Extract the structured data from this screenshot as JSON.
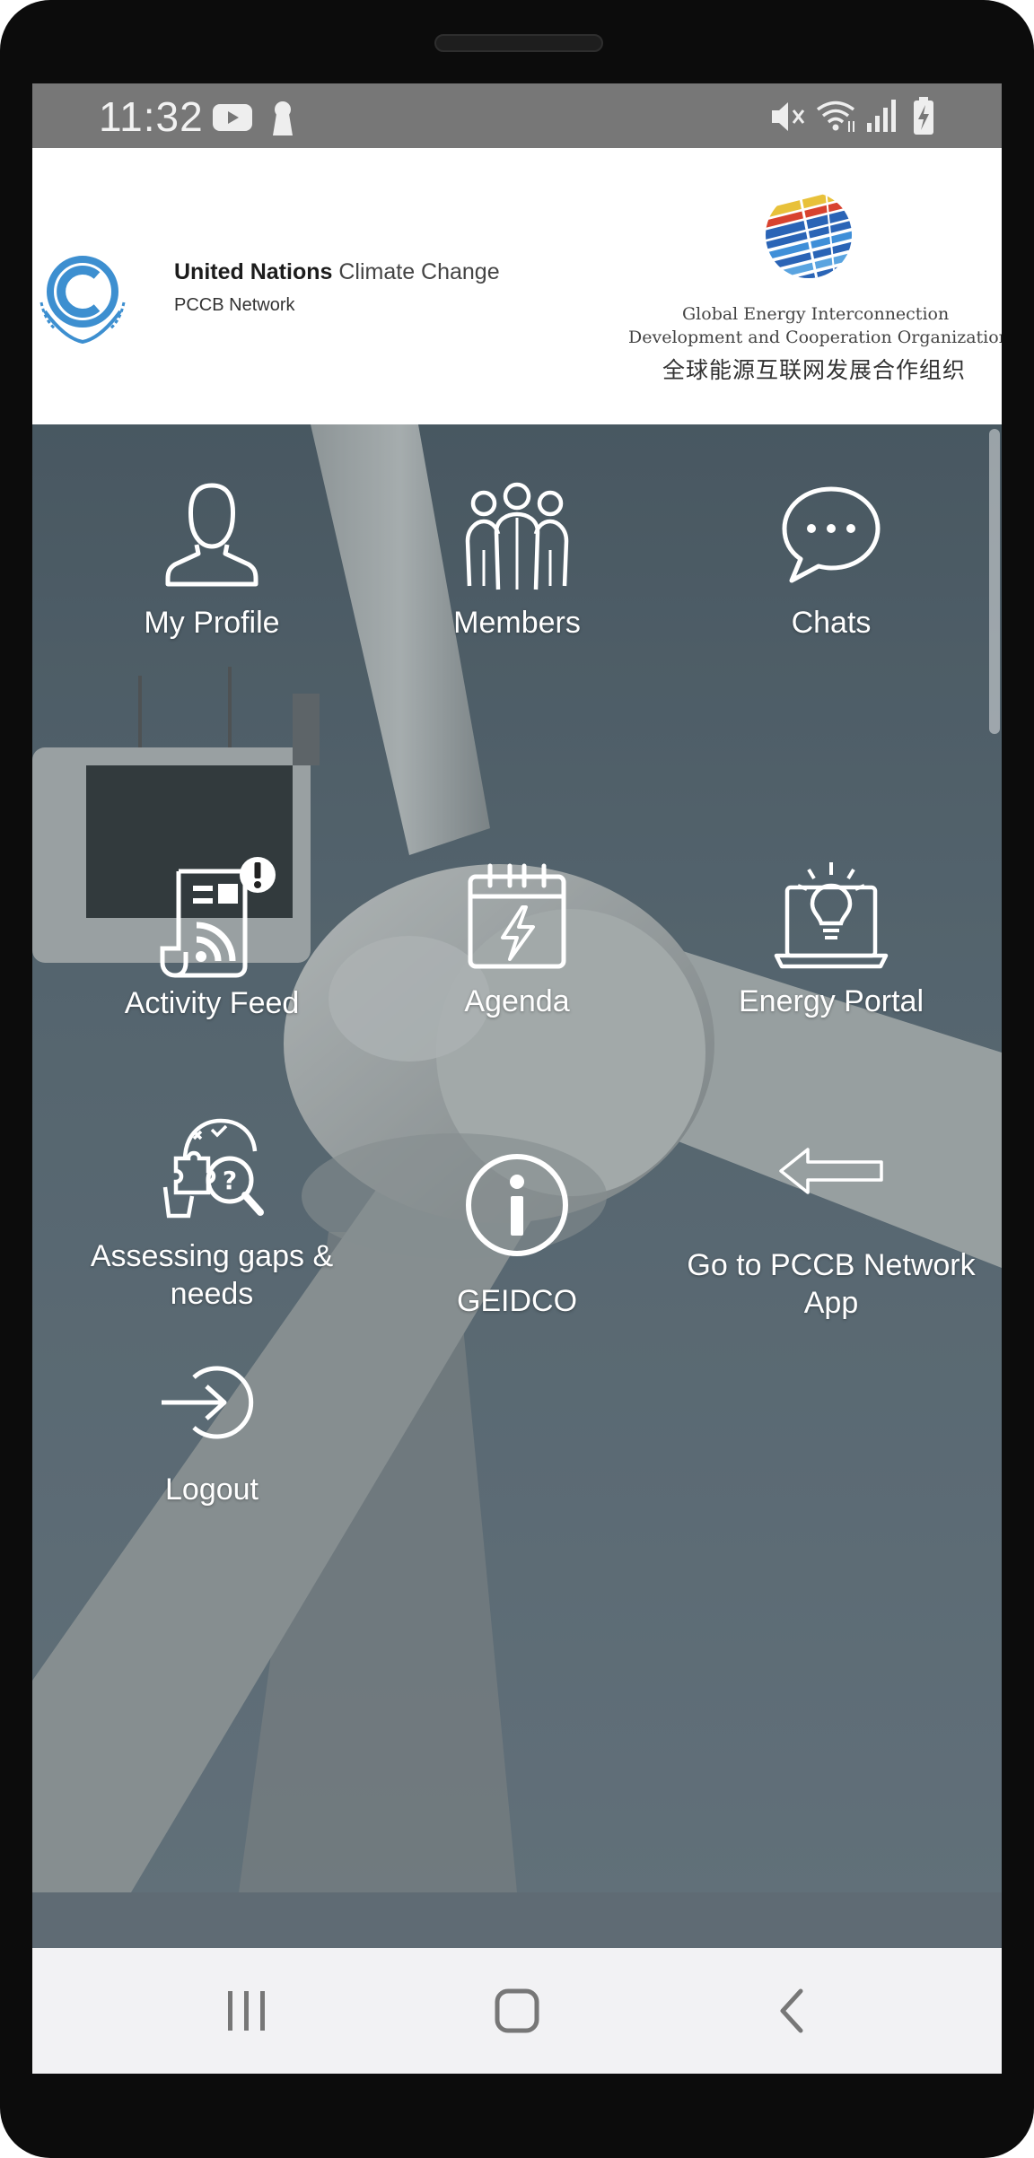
{
  "status_bar": {
    "time": "11:32",
    "left_icons": [
      "youtube-icon",
      "keyhole-icon"
    ],
    "right_icons": [
      "mute-icon",
      "wifi-icon",
      "signal-icon",
      "battery-charging-icon"
    ]
  },
  "header": {
    "un_title_bold": "United Nations",
    "un_title_light": "Climate Change",
    "un_subtitle": "PCCB Network",
    "geidco_line1": "Global Energy Interconnection",
    "geidco_line2": "Development and Cooperation Organization",
    "geidco_cn": "全球能源互联网发展合作组织"
  },
  "menu": {
    "my_profile": "My Profile",
    "members": "Members",
    "chats": "Chats",
    "activity_feed": "Activity Feed",
    "agenda": "Agenda",
    "energy_portal": "Energy Portal",
    "assessing_line1": "Assessing gaps &",
    "assessing_line2": "needs",
    "geidco": "GEIDCO",
    "pccb_line1": "Go to PCCB Network",
    "pccb_line2": "App",
    "logout": "Logout"
  },
  "nav_bar": {
    "icons": [
      "recent-apps-icon",
      "home-icon",
      "back-icon"
    ]
  }
}
